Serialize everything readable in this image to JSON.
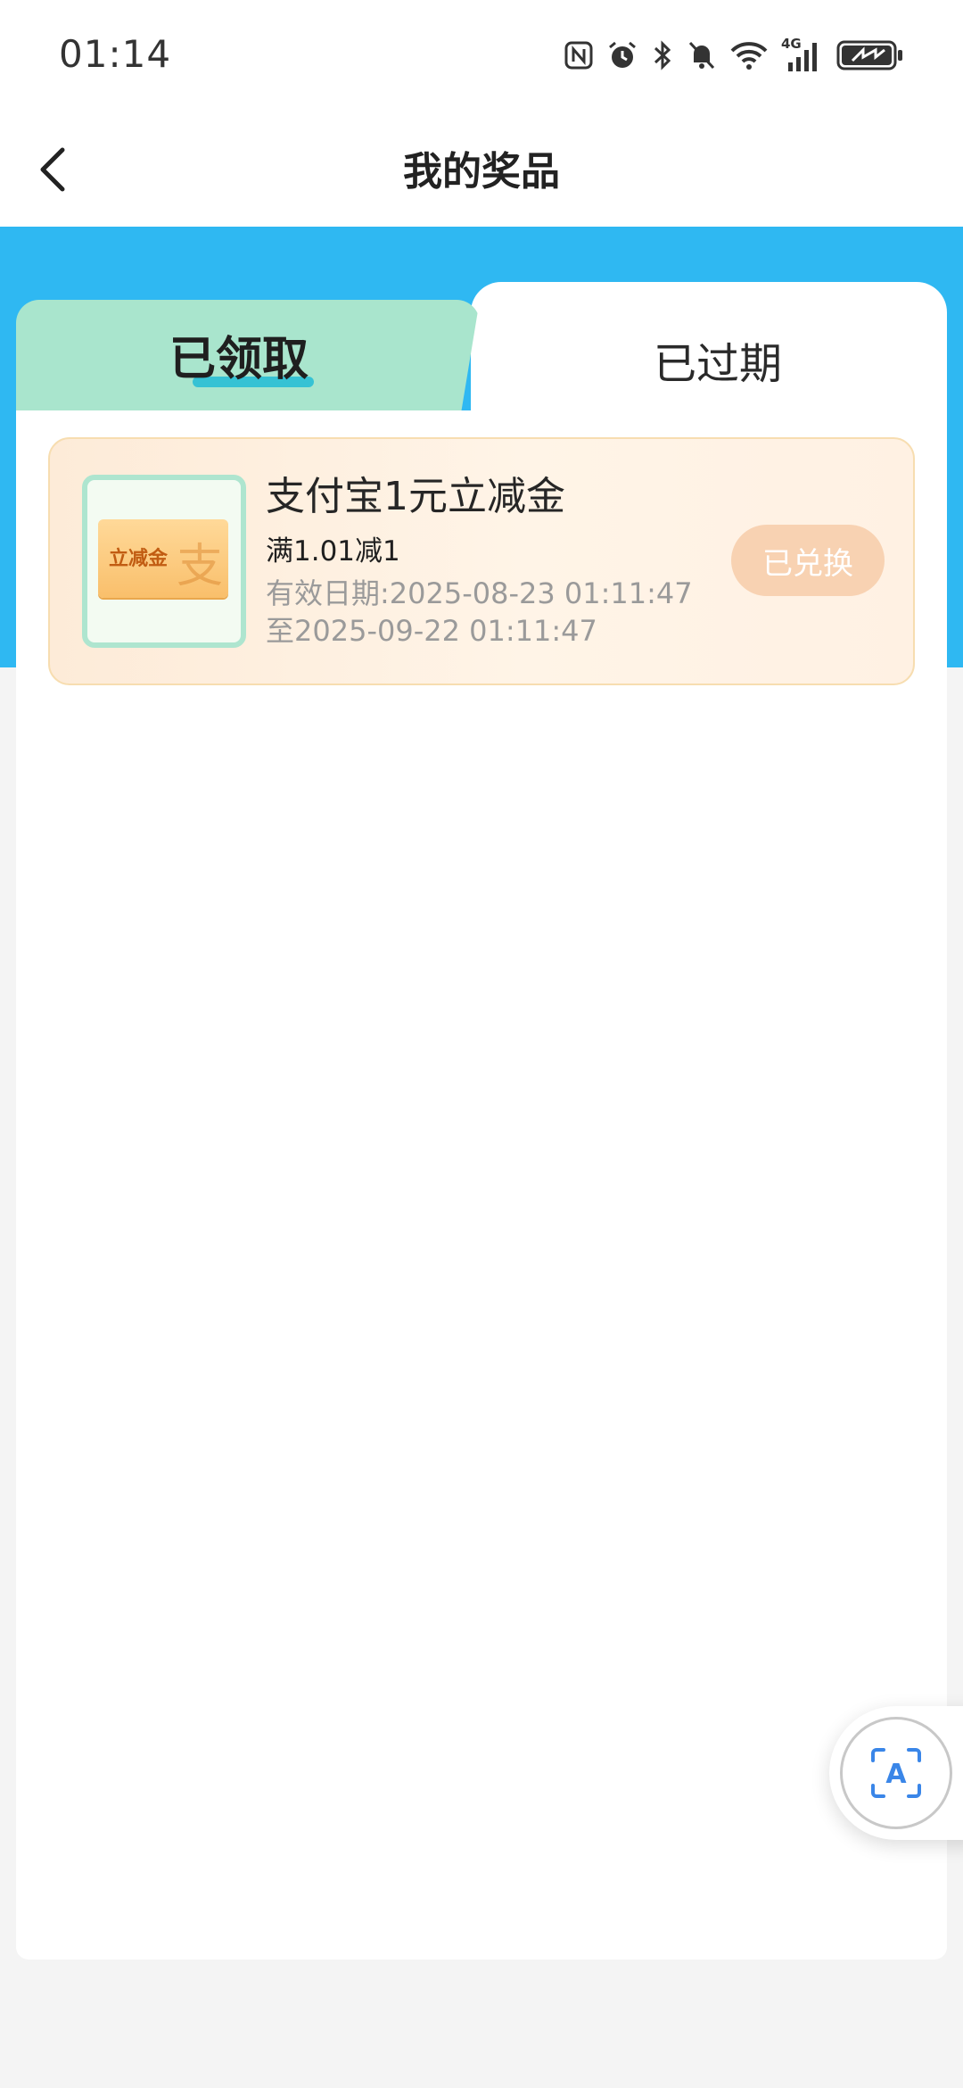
{
  "status_bar": {
    "time": "01:14",
    "icons": [
      "nfc-icon",
      "alarm-icon",
      "bluetooth-icon",
      "mute-icon",
      "wifi-icon",
      "4g-signal-icon",
      "battery-charging-icon"
    ],
    "network_label": "4G"
  },
  "nav": {
    "title": "我的奖品",
    "back_icon": "chevron-left-icon"
  },
  "tabs": [
    {
      "label": "已领取",
      "active": true
    },
    {
      "label": "已过期",
      "active": false
    }
  ],
  "prize": {
    "thumbnail": {
      "voucher_label": "立减金",
      "logo_glyph": "支"
    },
    "title": "支付宝1元立减金",
    "rule": "满1.01减1",
    "valid_from": "有效日期:2025-08-23 01:11:47",
    "valid_to": "至2025-09-22 01:11:47",
    "status_button": "已兑换"
  },
  "floating_button": {
    "icon": "text-scan-icon",
    "letter": "A"
  },
  "colors": {
    "header_band": "#2fb8f2",
    "active_tab": "#a9e5cd",
    "tab_underline": "#36c2d4",
    "card_border": "#f7ddb0",
    "redeemed_button": "#f8d2b2"
  }
}
